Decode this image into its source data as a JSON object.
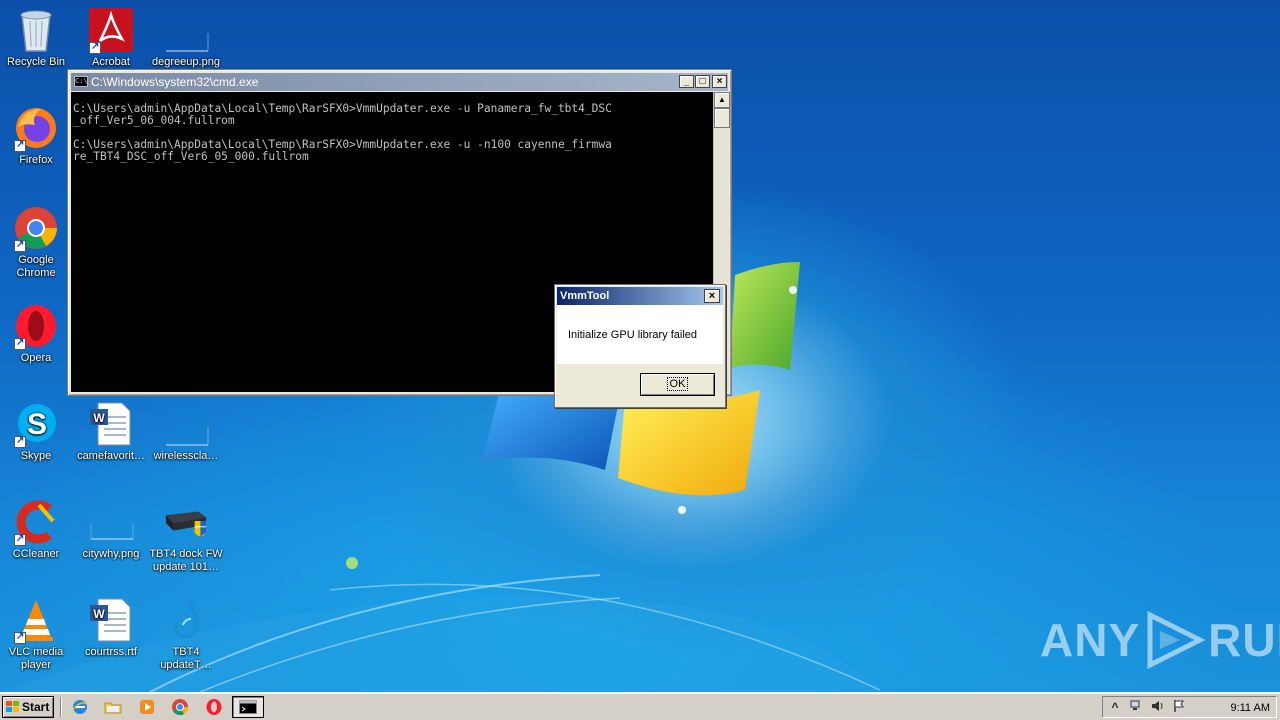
{
  "desktop": {
    "icons": [
      {
        "label": "Recycle Bin",
        "icon": "recycle-bin-icon"
      },
      {
        "label": "Acrobat",
        "icon": "acrobat-icon"
      },
      {
        "label": "degreeup.png",
        "icon": "image-file-icon"
      },
      {
        "label": "Firefox",
        "icon": "firefox-icon"
      },
      {
        "label": "Google Chrome",
        "icon": "chrome-icon"
      },
      {
        "label": "Opera",
        "icon": "opera-icon"
      },
      {
        "label": "Skype",
        "icon": "skype-icon"
      },
      {
        "label": "camefavorit…",
        "icon": "word-document-icon"
      },
      {
        "label": "wirelesscla…",
        "icon": "image-file-icon"
      },
      {
        "label": "CCleaner",
        "icon": "ccleaner-icon"
      },
      {
        "label": "citywhy.png",
        "icon": "image-file-icon"
      },
      {
        "label": "TBT4 dock FW update 101…",
        "icon": "installer-icon"
      },
      {
        "label": "VLC media player",
        "icon": "vlc-icon"
      },
      {
        "label": "courtrss.rtf",
        "icon": "word-document-icon"
      },
      {
        "label": "TBT4 updateT…",
        "icon": "water-drop-icon"
      }
    ]
  },
  "cmd": {
    "title": "C:\\Windows\\system32\\cmd.exe",
    "lines": [
      "C:\\Users\\admin\\AppData\\Local\\Temp\\RarSFX0>VmmUpdater.exe -u Panamera_fw_tbt4_DSC",
      "_off_Ver5_06_004.fullrom",
      "",
      "C:\\Users\\admin\\AppData\\Local\\Temp\\RarSFX0>VmmUpdater.exe -u -n100 cayenne_firmwa",
      "re_TBT4_DSC_off_Ver6_05_000.fullrom"
    ],
    "minimize": "_",
    "maximize": "□",
    "close": "×"
  },
  "msgbox": {
    "title": "VmmTool",
    "message": "Initialize GPU library failed",
    "ok_label": "OK",
    "close": "×"
  },
  "watermark": {
    "text_left": "ANY",
    "text_right": "RUN"
  },
  "taskbar": {
    "start_label": "Start",
    "quick_launch": [
      "ie-icon",
      "explorer-icon",
      "media-player-icon",
      "chrome-icon",
      "opera-icon"
    ],
    "active_task": "cmd-icon",
    "tray": {
      "chevron": "^",
      "clock": "9:11 AM"
    }
  }
}
